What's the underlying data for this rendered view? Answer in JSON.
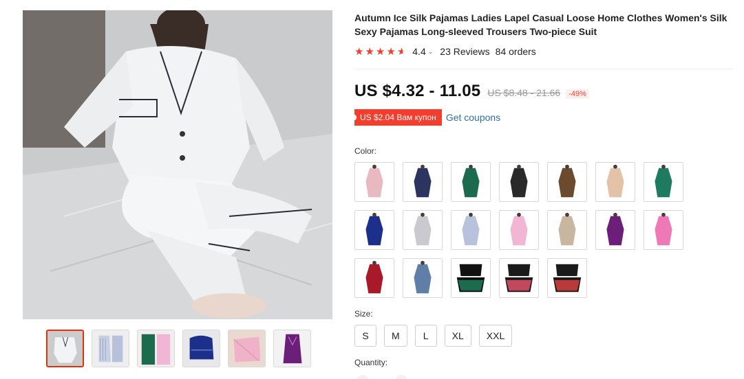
{
  "product": {
    "title": "Autumn Ice Silk Pajamas Ladies Lapel Casual Loose Home Clothes Women's Silk Sexy Pajamas Long-sleeved Trousers Two-piece Suit",
    "rating": "4.4",
    "rating_value": 4.4,
    "reviews": "23 Reviews",
    "orders": "84 orders",
    "price": "US $4.32 - 11.05",
    "old_price": "US $8.48 - 21.66",
    "discount": "-49%",
    "coupon_badge": "US $2.04 Вам купон",
    "coupon_link": "Get coupons",
    "color_label": "Color:",
    "size_label": "Size:",
    "quantity_label": "Quantity:",
    "sizes": [
      "S",
      "M",
      "L",
      "XL",
      "XXL"
    ]
  },
  "colors": {
    "accent_red": "#f53d2d",
    "thumb_active_border": "#e62e04",
    "link_blue": "#2c6ea8",
    "swatches": [
      "#e8b9c0",
      "#2b3560",
      "#1d6b4f",
      "#2a2a2a",
      "#6b4a2e",
      "#e3c2a8",
      "#1f7b5f",
      "#1c2f8a",
      "#c9c9cf",
      "#b8c2dd",
      "#f0b6d3",
      "#c8b6a0",
      "#6b1f78",
      "#ef79b6",
      "#a8192a",
      "#5f7fa8",
      "#1d6b4f",
      "#c2485e",
      "#b83a3a"
    ]
  },
  "thumbnails": [
    "white",
    "blue-stripe",
    "green-pink",
    "navy",
    "pink",
    "purple"
  ]
}
